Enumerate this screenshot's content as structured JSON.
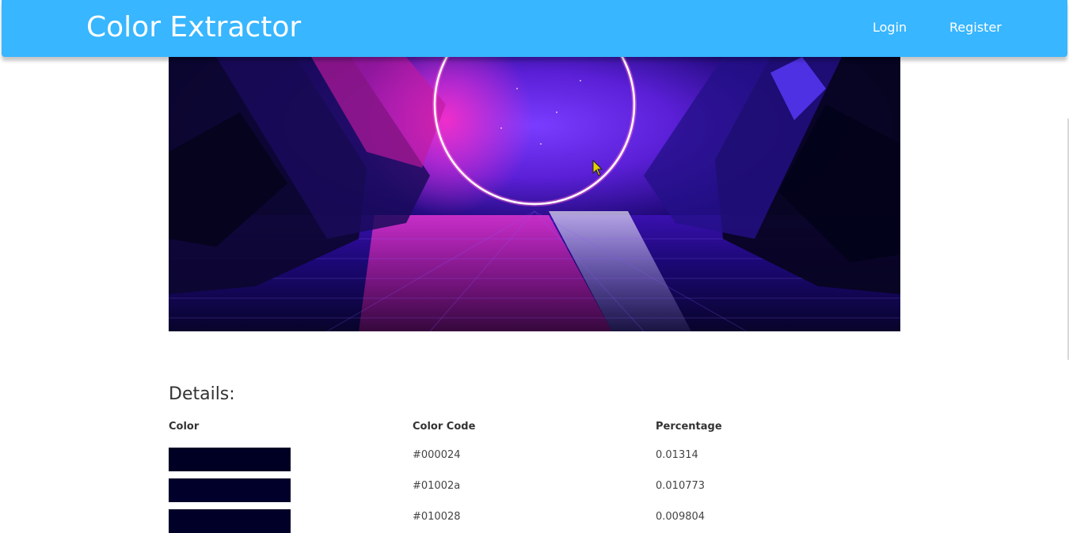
{
  "header": {
    "brand": "Color Extractor",
    "nav": [
      {
        "label": "Login"
      },
      {
        "label": "Register"
      }
    ],
    "color": "#38b6ff"
  },
  "hero": {
    "image_description_icon": "neon-ring-corridor-image"
  },
  "details": {
    "title": "Details:",
    "columns": [
      "Color",
      "Color Code",
      "Percentage"
    ],
    "rows": [
      {
        "color": "#000024",
        "code": "#000024",
        "percentage": "0.01314"
      },
      {
        "color": "#01002a",
        "code": "#01002a",
        "percentage": "0.010773"
      },
      {
        "color": "#010028",
        "code": "#010028",
        "percentage": "0.009804"
      }
    ]
  }
}
